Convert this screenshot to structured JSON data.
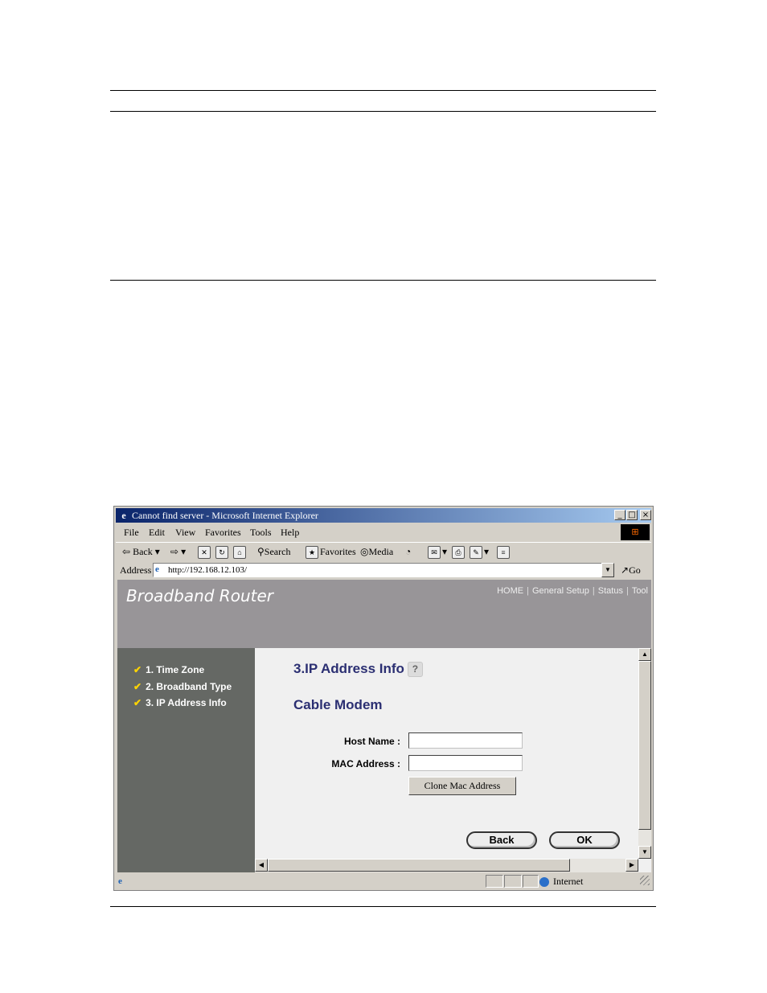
{
  "window": {
    "title": "Cannot find server - Microsoft Internet Explorer",
    "controls": [
      "_",
      "□",
      "×"
    ]
  },
  "menu": [
    "File",
    "Edit",
    "View",
    "Favorites",
    "Tools",
    "Help"
  ],
  "toolbar": {
    "back": "Back",
    "search": "Search",
    "favorites": "Favorites",
    "media": "Media"
  },
  "address": {
    "label": "Address",
    "url": "http://192.168.12.103/",
    "go": "Go"
  },
  "page": {
    "brand": "Broadband Router",
    "nav": [
      "HOME",
      "General Setup",
      "Status",
      "Tool"
    ],
    "steps": [
      "1. Time Zone",
      "2. Broadband Type",
      "3. IP Address Info"
    ],
    "heading": "3.IP Address Info",
    "subheading": "Cable Modem",
    "host_label": "Host Name :",
    "host_value": "",
    "mac_label": "MAC Address :",
    "mac_value": "",
    "clone_button": "Clone Mac Address",
    "back_button": "Back",
    "ok_button": "OK"
  },
  "status": {
    "zone": "Internet"
  },
  "colors": {
    "title_start": "#0a246a",
    "header_bg": "#989598",
    "sidebar_bg": "#656864",
    "heading": "#2b2f72",
    "check": "#ffd400"
  }
}
